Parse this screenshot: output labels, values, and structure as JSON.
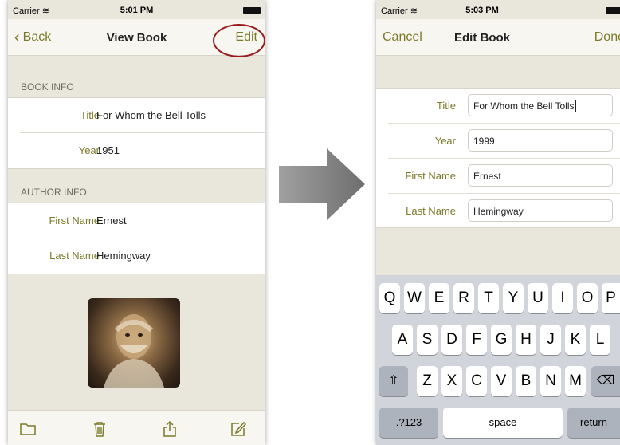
{
  "left_screen": {
    "status": {
      "carrier": "Carrier",
      "time": "5:01 PM"
    },
    "nav": {
      "back": "Back",
      "title": "View Book",
      "edit": "Edit"
    },
    "sections": [
      {
        "header": "BOOK INFO",
        "rows": [
          {
            "label": "Title",
            "value": "For Whom the Bell Tolls"
          },
          {
            "label": "Year",
            "value": "1951"
          }
        ]
      },
      {
        "header": "AUTHOR INFO",
        "rows": [
          {
            "label": "First Name",
            "value": "Ernest"
          },
          {
            "label": "Last Name",
            "value": "Hemingway"
          }
        ]
      }
    ],
    "toolbar_icons": [
      "folder-icon",
      "trash-icon",
      "share-icon",
      "compose-icon"
    ]
  },
  "right_screen": {
    "status": {
      "carrier": "Carrier",
      "time": "5:03 PM"
    },
    "nav": {
      "cancel": "Cancel",
      "title": "Edit Book",
      "done": "Done"
    },
    "fields": [
      {
        "label": "Title",
        "value": "For Whom the Bell Tolls"
      },
      {
        "label": "Year",
        "value": "1999"
      },
      {
        "label": "First Name",
        "value": "Ernest"
      },
      {
        "label": "Last Name",
        "value": "Hemingway"
      }
    ],
    "keyboard": {
      "row1": [
        "Q",
        "W",
        "E",
        "R",
        "T",
        "Y",
        "U",
        "I",
        "O",
        "P"
      ],
      "row2": [
        "A",
        "S",
        "D",
        "F",
        "G",
        "H",
        "J",
        "K",
        "L"
      ],
      "row3": [
        "Z",
        "X",
        "C",
        "V",
        "B",
        "N",
        "M"
      ],
      "shift": "⇧",
      "delete": "⌫",
      "numbers": ".?123",
      "space": "space",
      "return": "return"
    }
  },
  "colors": {
    "accent": "#7c7a2a",
    "highlight_circle": "#9a1a1a",
    "background": "#e9e6dc"
  }
}
